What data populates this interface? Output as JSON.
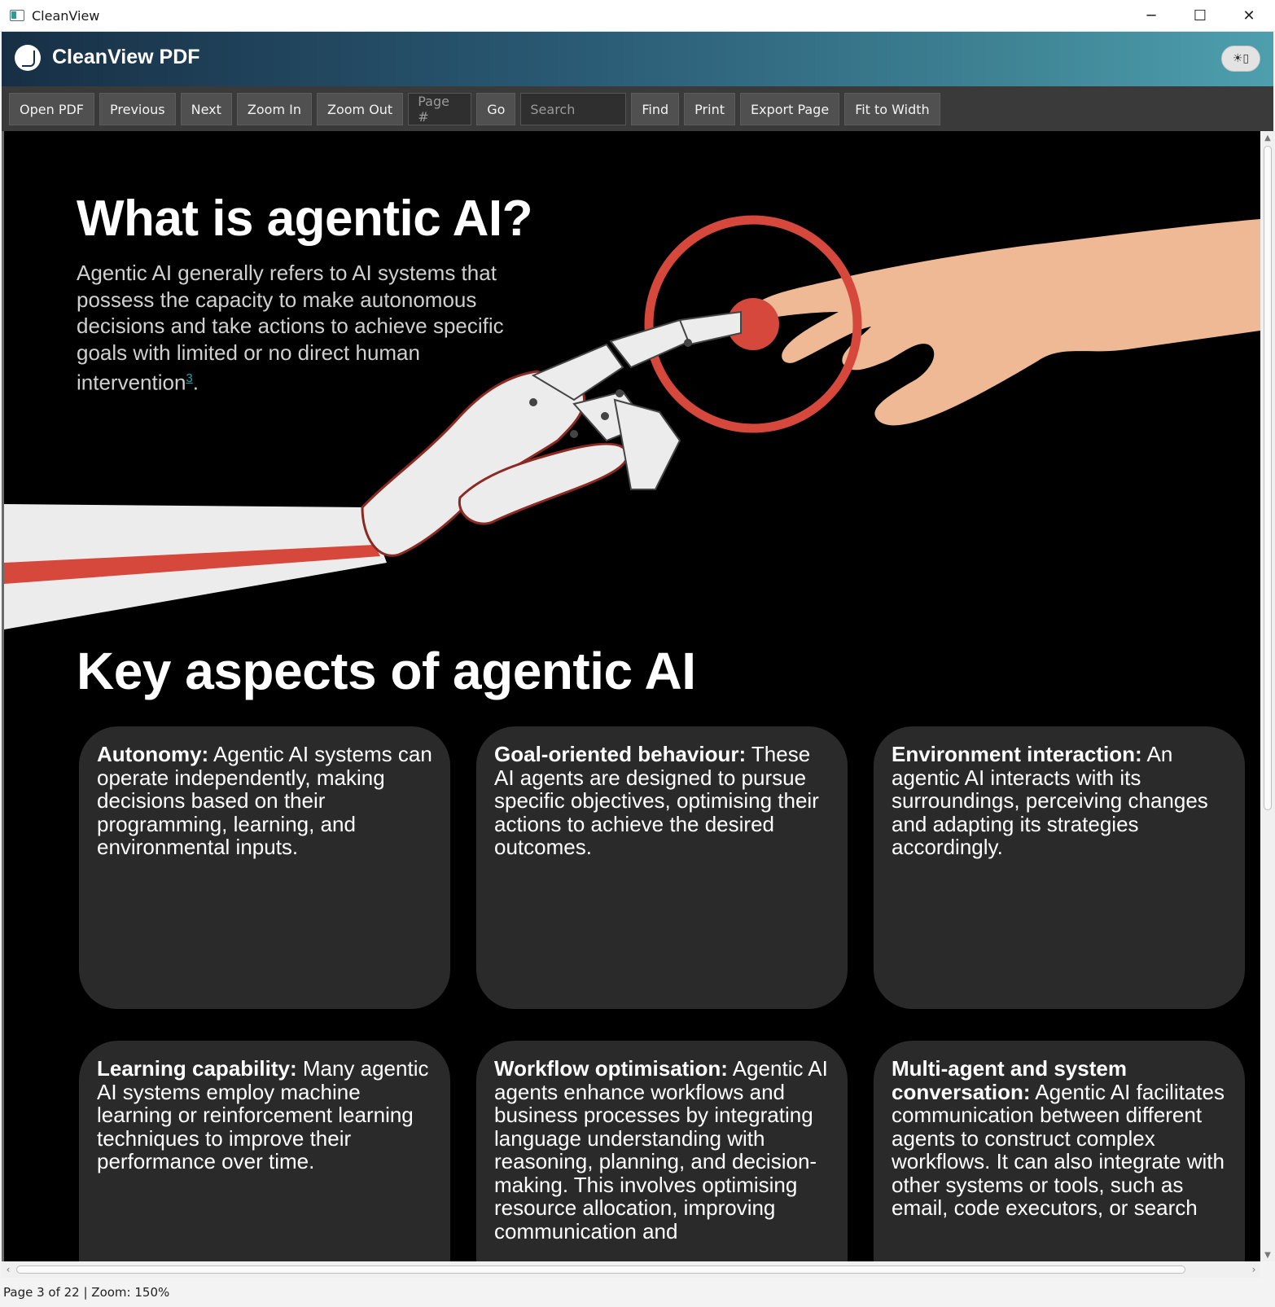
{
  "window": {
    "title": "CleanView",
    "controls": {
      "minimize": "─",
      "maximize": "☐",
      "close": "✕"
    }
  },
  "header": {
    "brand": "CleanView PDF",
    "theme_toggle": "☀▯"
  },
  "toolbar": {
    "open": "Open PDF",
    "previous": "Previous",
    "next": "Next",
    "zoom_in": "Zoom In",
    "zoom_out": "Zoom Out",
    "page_placeholder": "Page #",
    "go": "Go",
    "search_placeholder": "Search",
    "find": "Find",
    "print": "Print",
    "export": "Export Page",
    "fit": "Fit to Width"
  },
  "document": {
    "heading": "What is agentic AI?",
    "intro": "Agentic AI generally refers to AI systems that possess the capacity to make autonomous decisions and take actions to achieve specific goals with limited or no direct human intervention",
    "footnote": "3",
    "intro_end": ".",
    "section_heading": "Key aspects of agentic AI",
    "cards": [
      {
        "term": "Autonomy:",
        "text": " Agentic AI systems can operate independently, making decisions based on their programming, learning, and environmental inputs."
      },
      {
        "term": "Goal-oriented behaviour:",
        "text": " These AI agents are designed to pursue specific objectives, optimising their actions to achieve the desired outcomes."
      },
      {
        "term": "Environment interaction:",
        "text": " An agentic AI interacts with its surroundings, perceiving changes and adapting its strategies accordingly."
      },
      {
        "term": "Learning capability:",
        "text": " Many agentic AI systems employ machine learning or reinforcement learning techniques to improve their performance over time."
      },
      {
        "term": "Workflow optimisation:",
        "text": " Agentic AI agents enhance workflows and business processes by integrating language understanding with reasoning, planning, and decision-making. This involves optimising resource allocation, improving communication and"
      },
      {
        "term": "Multi-agent and system conversation:",
        "text": " Agentic AI facilitates communication between different agents to construct complex workflows. It can also integrate with other systems or tools, such as email, code executors, or search"
      }
    ]
  },
  "status": {
    "text": "Page 3 of 22 | Zoom: 150%",
    "current_page": 3,
    "total_pages": 22,
    "zoom": "150%"
  },
  "colors": {
    "accent_red": "#d5483b",
    "skin": "#efb996",
    "robot": "#ececec",
    "card_bg": "#2a2a2a",
    "link": "#1fa0a8"
  }
}
